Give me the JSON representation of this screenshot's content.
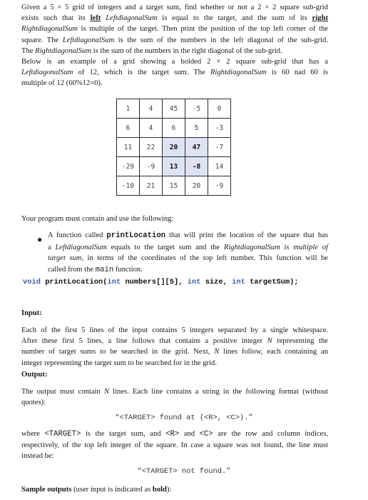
{
  "intro": {
    "line1": "Given a 5 × 5 grid of integers and a target sum, find whether or not a 2 × 2 square sub-grid",
    "line2_a": "exists such that its ",
    "line2_left": "left",
    "line2_b": " ",
    "line2_lds": "LeftdiagonalSum",
    "line2_c": " is equal to the target, and the sum of its ",
    "line2_right": "right",
    "line3_rds": "RightdiagonalSum",
    "line3_b": " is multiple of the target. Then print the position of the top left corner of the",
    "line4_a": "square. The ",
    "line4_lds": "LeftdiagonalSum",
    "line4_b": " is the sum of the numbers in the left diagonal of the sub-grid.",
    "line5_a": "The ",
    "line5_rds": "RightdiagonalSum",
    "line5_b": " is the sum of the numbers in the right diagonal of the sub-grid.",
    "line6": "Below is an example of a grid showing a bolded 2 × 2 square sub-grid that has a",
    "line7_lds": "LeftdiagonalSum",
    "line7_a": " of  12, which is the target sum. The ",
    "line7_rds": "RightdiagonalSum",
    "line7_b": " is 60 nad 60 is",
    "line8": "multiple of 12 (60%12=0)."
  },
  "grid": {
    "rows": [
      [
        "1",
        "4",
        "45",
        "-5",
        "0"
      ],
      [
        "6",
        "4",
        "6",
        "5",
        "-3"
      ],
      [
        "11",
        "22",
        "20",
        "47",
        "-7"
      ],
      [
        "-29",
        "-9",
        "13",
        "-8",
        "14"
      ],
      [
        "-10",
        "21",
        "15",
        "20",
        "-9"
      ]
    ],
    "highlight_color": "#dde3f3"
  },
  "requirements": {
    "intro": "Your program must contain and use the following:",
    "bullet": {
      "a": "A function called ",
      "fn": "printLocation",
      "b": " that will print the location of the square that has",
      "c": "a ",
      "lds": "LeftdiagonalSum",
      "d": " equals to the target sum and the ",
      "rds_phrase": "RightdiagonalSum is multiple of",
      "target_sum": "target sum",
      "e": ", in terms of the coordinates of the top left number. This function will be",
      "f": "called from the ",
      "main": "main",
      "g": " function."
    },
    "signature": {
      "void": "void",
      "name": " printLocation(",
      "int1": "int",
      "p1": " numbers[][5], ",
      "int2": "int",
      "p2": " size, ",
      "int3": "int",
      "p3": " targetSum);",
      "keyword_color": "#3d5fa6"
    }
  },
  "input_section": {
    "heading": "Input:",
    "line1": "Each of the first 5 lines of the input contains 5 integers separated by a single whitespace.",
    "line2_a": "After these first 5 lines, a line follows that contains a positive integer ",
    "line2_n": "N",
    "line2_b": " representing the",
    "line3_a": "number of target sums to be searched in the grid. Next, ",
    "line3_n": "N",
    "line3_b": " lines follow, each containing an",
    "line4": "integer representing the target sum to be searched for in the grid."
  },
  "output_section": {
    "heading": "Output:",
    "line1_a": "The output must contain ",
    "line1_n": "N",
    "line1_b": " lines. Each line contains a string in the following format (without",
    "line2": "quotes):",
    "format_found": "“<TARGET> found at (<R>, <C>).”",
    "where_a": "where ",
    "where_target": "<TARGET>",
    "where_b": " is the target sum, and ",
    "where_r": "<R>",
    "where_c_and": " and ",
    "where_c": "<C>",
    "where_d": " are the row and column indices,",
    "line4": "respectively, of the top left integer of the square. In case a square was not found, the line must",
    "line5": "instead be:",
    "format_not_found": "“<TARGET> not found.”"
  },
  "sample": {
    "bold_a": "Sample outputs",
    "b": " (user input is indicated as ",
    "bold_b": "bold",
    "c": "):"
  }
}
